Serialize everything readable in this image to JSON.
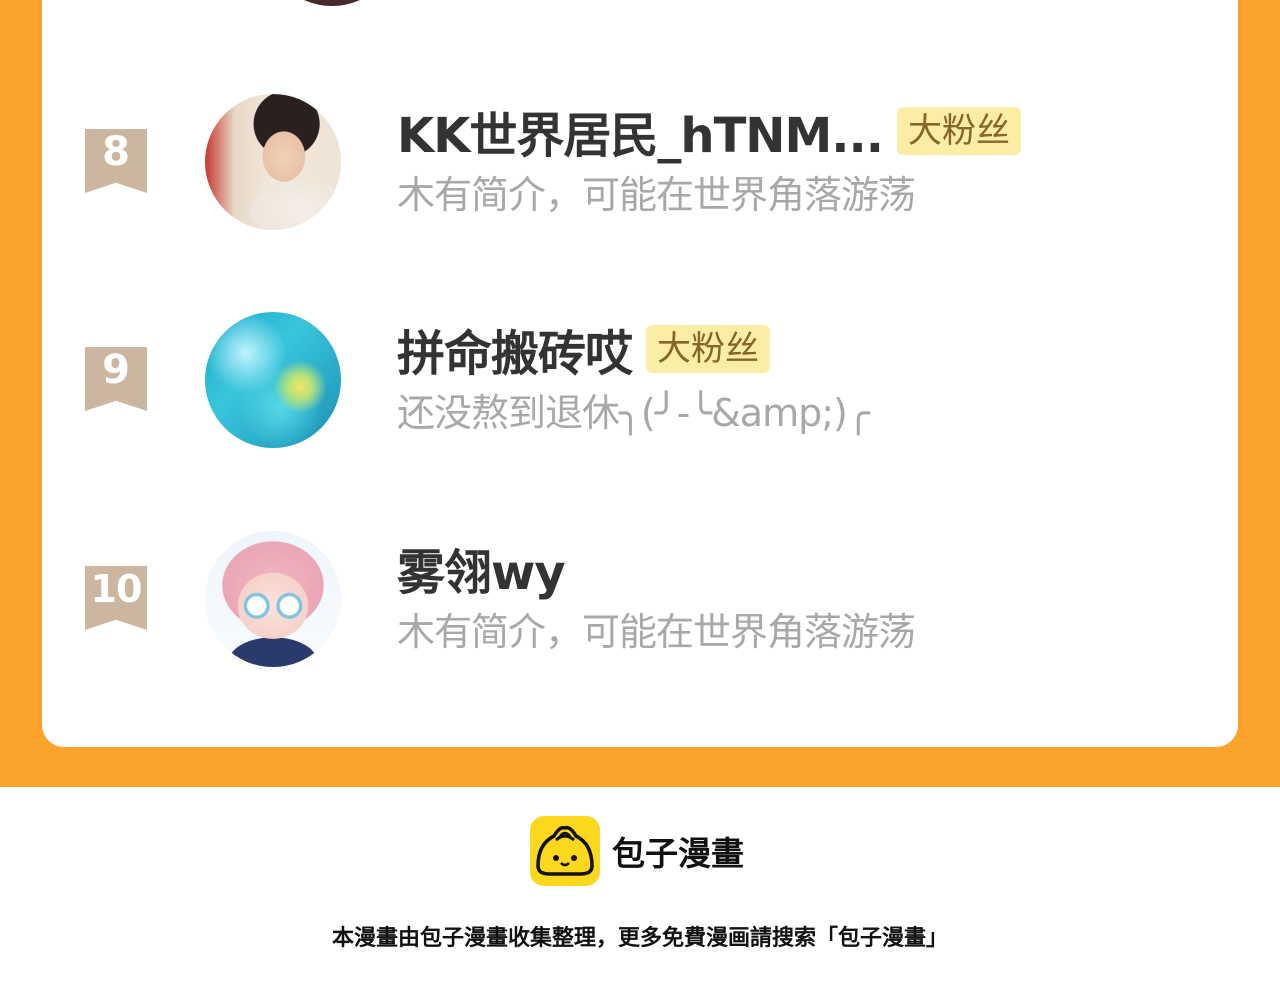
{
  "ranking": [
    {
      "rank": "8",
      "name": "KK世界居民_hTNM...",
      "badge": "大粉丝",
      "bio": "木有简介，可能在世界角落游荡",
      "avatar": "avatar-selfie-photo"
    },
    {
      "rank": "9",
      "name": "拼命搬砖哎",
      "badge": "大粉丝",
      "bio": "还没熬到退休╮(╯-╰&amp;)╭",
      "avatar": "avatar-blue-crystal"
    },
    {
      "rank": "10",
      "name": "雾翎wy",
      "badge": "",
      "bio": "木有简介，可能在世界角落游荡",
      "avatar": "avatar-anime-girl"
    }
  ],
  "footer": {
    "brand_name": "包子漫畫",
    "logo_icon": "bun-logo-icon",
    "note": "本漫畫由包子漫畫收集整理，更多免費漫画請搜索「包子漫畫」"
  },
  "colors": {
    "background_orange": "#fba22c",
    "badge_bg": "#fbeca6",
    "badge_text": "#86642a",
    "rank_ribbon": "#cdb69f",
    "logo_yellow": "#fbd81e"
  }
}
